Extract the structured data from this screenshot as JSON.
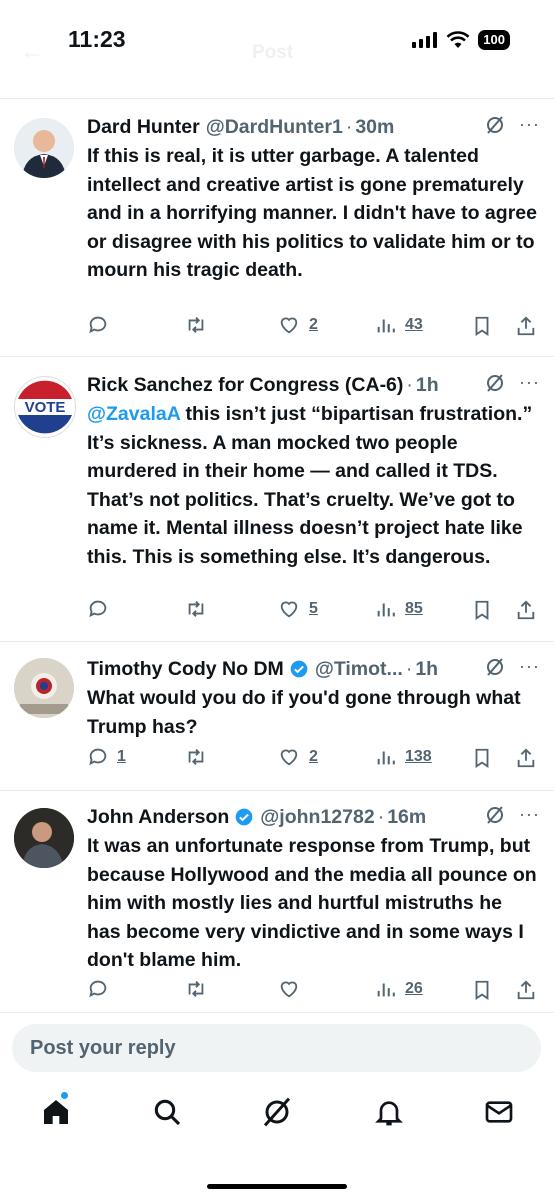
{
  "status": {
    "time": "11:23",
    "battery": "100"
  },
  "nav": {
    "title": "Post"
  },
  "colors": {
    "accent": "#1d9bf0",
    "secondary_text": "#536471",
    "divider": "#e7e9ea"
  },
  "tweets": [
    {
      "name": "Dard Hunter",
      "handle": "@DardHunter1",
      "sep": "·",
      "time": "30m",
      "mention": "",
      "text": "If this is real, it is utter garbage.  A talented intellect and creative artist is gone prematurely and in a horrifying manner.  I didn't have to agree or disagree with his politics to validate him or to mourn his tragic death.",
      "replies": "",
      "reposts": "",
      "likes": "2",
      "views": "43"
    },
    {
      "name": "Rick Sanchez for Congress (CA-6)",
      "handle": "",
      "sep": "·",
      "time": "1h",
      "mention": "@ZavalaA",
      "text": " this isn’t just “bipartisan frustration.” It’s sickness. A man mocked two people murdered in their home — and called it TDS. That’s not politics. That’s cruelty. We’ve got to name it. Mental illness doesn’t project hate like this. This is something else. It’s dangerous.",
      "avatar_text": "VOTE",
      "replies": "",
      "reposts": "",
      "likes": "5",
      "views": "85"
    },
    {
      "name": "Timothy Cody No DM",
      "handle": "@Timot...",
      "sep": "·",
      "time": "1h",
      "mention": "",
      "text": "What would you do if you'd gone through what Trump has?",
      "replies": "1",
      "reposts": "",
      "likes": "2",
      "views": "138"
    },
    {
      "name": "John Anderson",
      "handle": "@john12782",
      "sep": "·",
      "time": "16m",
      "mention": "",
      "text": "It was an unfortunate response from Trump, but because Hollywood and the media all pounce on him with mostly lies and hurtful mistruths he has become very vindictive and in some ways I don't blame him.",
      "replies": "",
      "reposts": "",
      "likes": "",
      "views": "26"
    }
  ],
  "reply_box": {
    "placeholder": "Post your reply"
  },
  "more_icon": "···",
  "tabbar": [
    "home-icon",
    "search-icon",
    "grok-icon",
    "notifications-icon",
    "messages-icon"
  ]
}
